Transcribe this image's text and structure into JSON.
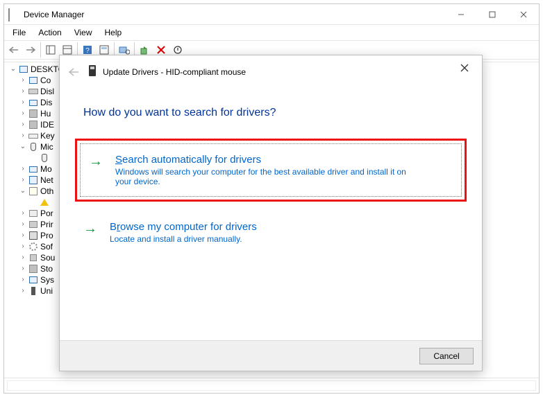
{
  "window": {
    "title": "Device Manager"
  },
  "menu": [
    "File",
    "Action",
    "View",
    "Help"
  ],
  "tree": {
    "root": "DESKTO",
    "items": [
      {
        "label": "Co",
        "exp": ">",
        "icon": "pc"
      },
      {
        "label": "Disl",
        "exp": ">",
        "icon": "drive"
      },
      {
        "label": "Dis",
        "exp": ">",
        "icon": "monitor"
      },
      {
        "label": "Hu",
        "exp": ">",
        "icon": "chip"
      },
      {
        "label": "IDE",
        "exp": ">",
        "icon": "chip"
      },
      {
        "label": "Key",
        "exp": ">",
        "icon": "kb"
      },
      {
        "label": "Mic",
        "exp": "v",
        "icon": "mouse",
        "children": [
          {
            "label": "",
            "icon": "mouse"
          }
        ]
      },
      {
        "label": "Mo",
        "exp": ">",
        "icon": "monitor"
      },
      {
        "label": "Net",
        "exp": ">",
        "icon": "net"
      },
      {
        "label": "Oth",
        "exp": "v",
        "icon": "other",
        "children": [
          {
            "label": "",
            "icon": "warn"
          }
        ]
      },
      {
        "label": "Por",
        "exp": ">",
        "icon": "port"
      },
      {
        "label": "Prir",
        "exp": ">",
        "icon": "print"
      },
      {
        "label": "Pro",
        "exp": ">",
        "icon": "cpu"
      },
      {
        "label": "Sof",
        "exp": ">",
        "icon": "gear"
      },
      {
        "label": "Sou",
        "exp": ">",
        "icon": "sound"
      },
      {
        "label": "Sto",
        "exp": ">",
        "icon": "chip"
      },
      {
        "label": "Sys",
        "exp": ">",
        "icon": "pc"
      },
      {
        "label": "Uni",
        "exp": ">",
        "icon": "usb"
      }
    ]
  },
  "dialog": {
    "title": "Update Drivers - HID-compliant mouse",
    "question": "How do you want to search for drivers?",
    "option1": {
      "title_pre": "S",
      "title_rest": "earch automatically for drivers",
      "desc": "Windows will search your computer for the best available driver and install it on your device."
    },
    "option2": {
      "title_pre": "B",
      "title_mid": "r",
      "title_rest": "owse my computer for drivers",
      "desc": "Locate and install a driver manually."
    },
    "cancel": "Cancel"
  }
}
